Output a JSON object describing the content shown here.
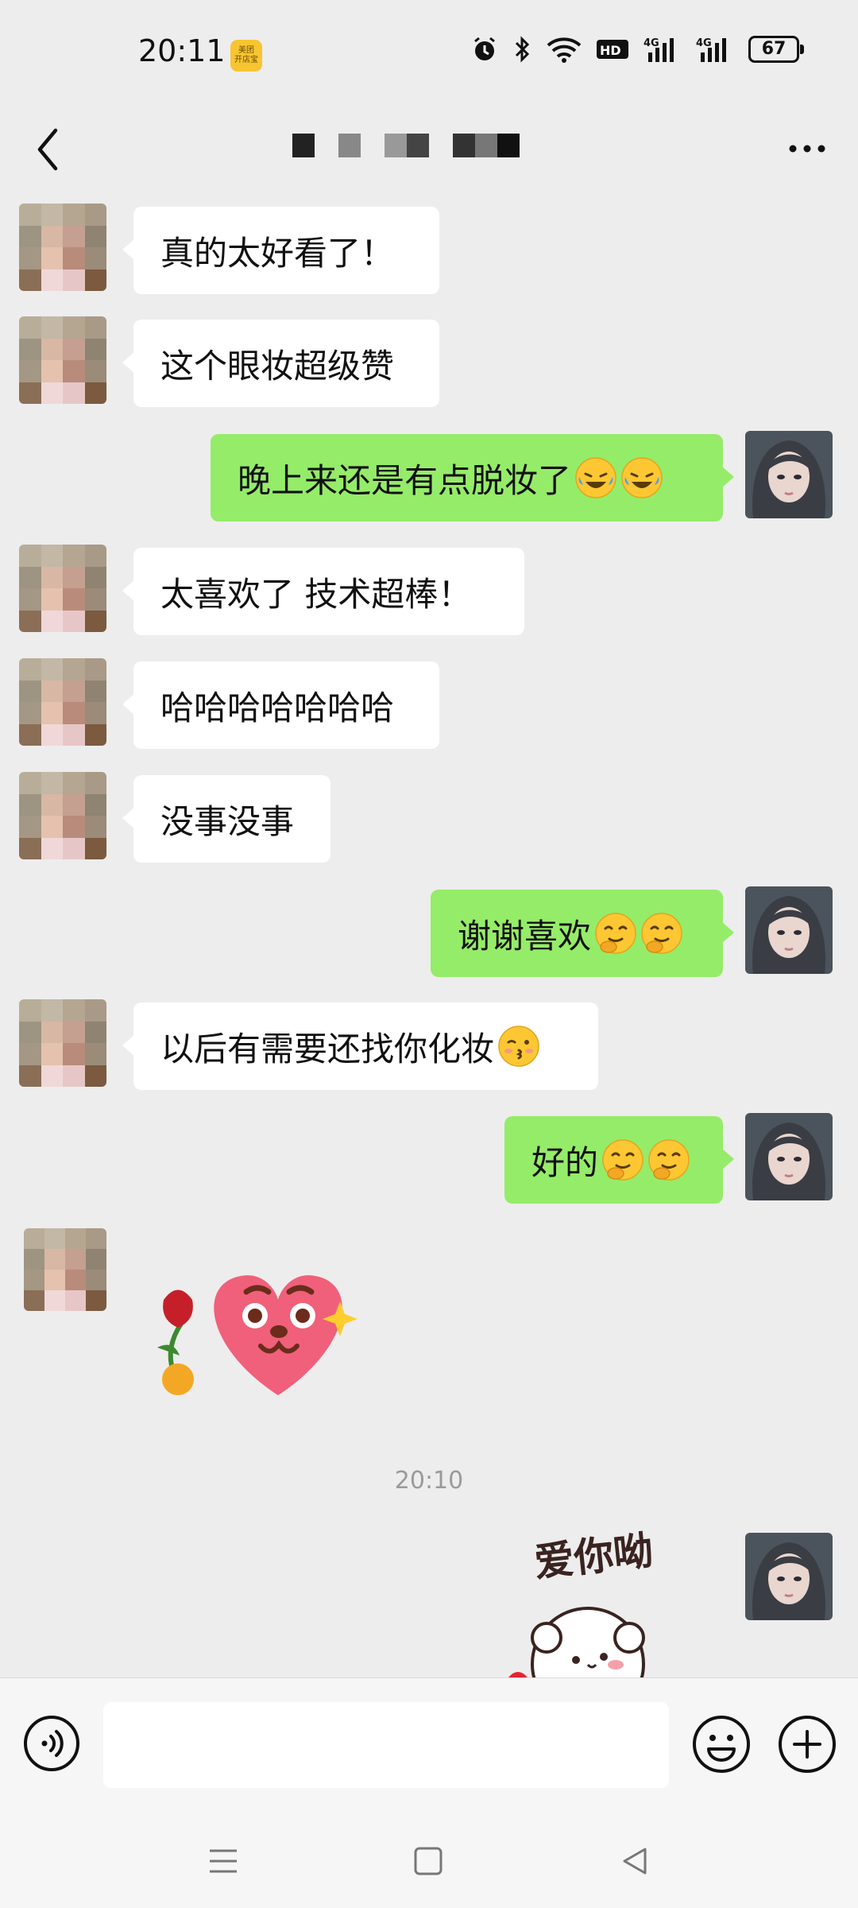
{
  "status_bar": {
    "time": "20:11",
    "app_badge_text": "美团\n开店宝",
    "battery": "67",
    "icons": [
      "alarm-icon",
      "bluetooth-icon",
      "wifi-icon",
      "hd-icon",
      "signal-4g-icon",
      "signal-4g-icon",
      "battery-icon"
    ]
  },
  "header": {
    "back_icon": "chevron-left-icon",
    "title_redacted": true,
    "more_icon": "more-dots-icon"
  },
  "messages": [
    {
      "side": "in",
      "text": "真的太好看了！"
    },
    {
      "side": "in",
      "text": "这个眼妆超级赞"
    },
    {
      "side": "out",
      "text": "晚上来还是有点脱妆了",
      "emoji": [
        "laugh-cry-emoji",
        "laugh-cry-emoji"
      ]
    },
    {
      "side": "in",
      "text": "太喜欢了 技术超棒！"
    },
    {
      "side": "in",
      "text": "哈哈哈哈哈哈哈"
    },
    {
      "side": "in",
      "text": "没事没事"
    },
    {
      "side": "out",
      "text": "谢谢喜欢",
      "emoji": [
        "hehe-emoji",
        "hehe-emoji"
      ]
    },
    {
      "side": "in",
      "text": "以后有需要还找你化妆",
      "emoji": [
        "kiss-emoji"
      ]
    },
    {
      "side": "out",
      "text": "好的",
      "emoji": [
        "hehe-emoji",
        "hehe-emoji"
      ]
    }
  ],
  "sticker_in": "heart-face-rose-sticker",
  "timestamp": "20:10",
  "sticker_out": {
    "text": "爱你呦",
    "name": "love-you-bear-sticker"
  },
  "input_bar": {
    "placeholder": "",
    "voice_icon": "voice-icon",
    "emoji_icon": "emoji-icon",
    "plus_icon": "plus-icon"
  },
  "system_nav": [
    "menu-icon",
    "home-icon",
    "back-triangle-icon"
  ],
  "colors": {
    "outgoing_bubble": "#95ec69",
    "incoming_bubble": "#ffffff",
    "background": "#ededed"
  }
}
